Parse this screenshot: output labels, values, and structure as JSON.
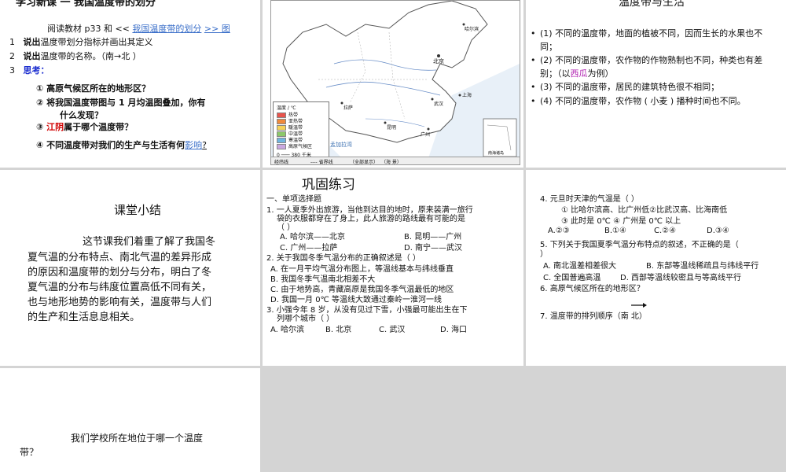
{
  "p1": {
    "title": "学习新课  一 我国温度带的划分",
    "read_prefix": "阅读教材 p33 和 <<",
    "read_link": "我国温度带的划分",
    "read_suffix": ">> 图",
    "item1_num": "1",
    "item1_bold": "说出",
    "item1_text": "温度带划分指标并画出其定义",
    "item2_num": "2",
    "item2_bold": "说出",
    "item2_text": "温度带的名称。（南→北 ）",
    "item3_num": "3",
    "item3_label": "思考：",
    "think1": "① 高原气候区所在的地形区？",
    "think2a": "② 将我国温度带图与 1 月均温图叠加，你有",
    "think2b": "什么发现？",
    "think3_prefix": "③ ",
    "think3_red": "江阴",
    "think3_suffix": "属于哪个温度带？",
    "think4_prefix": "④ 不同温度带对我们的生产与生活有何",
    "think4_link": "影响",
    "think4_suffix": "?"
  },
  "p2": {
    "legend_title": "温度 / ℃",
    "legend_items": [
      "热带",
      "亚热带",
      "暖温带",
      "中温带",
      "寒温带",
      "高原气候区"
    ],
    "legend_colors": [
      "#e8544c",
      "#f08a3c",
      "#f6d25a",
      "#8cc86a",
      "#6fb6e0",
      "#c9a8e0"
    ],
    "scale": "0 ─── 380 千米",
    "city_beijing": "北京",
    "city_harbin": "哈尔滨",
    "city_shanghai": "上海",
    "city_guangzhou": "广州",
    "city_lhasa": "拉萨",
    "city_wuhan": "武汉",
    "city_kunming": "昆明",
    "sea_label": "孟加拉湾",
    "inset_label": "南海诸岛",
    "bottom_a": "经纬线",
    "bottom_b": "---- 省界线",
    "bottom_c": "（全部显示）",
    "bottom_d": "（海 景）"
  },
  "p3": {
    "title": "温度带与生活",
    "b1": "(1) 不同的温度带，地面的植被不同，因而生长的水果也不同；",
    "b2_prefix": "(2) 不同的温度带，农作物的作物熟制也不同，种类也有差别；（以",
    "b2_purple": "西瓜",
    "b2_suffix": "为例）",
    "b3": "(3) 不同的温度带，居民的建筑特色很不相同；",
    "b4": "(4) 不同的温度带，农作物 ( 小麦 ) 播种时间也不同。"
  },
  "p4": {
    "title": "课堂小结",
    "lines": [
      "这节课我们着重了解了我国冬",
      "夏气温的分布特点、南北气温的差异形成",
      "的原因和温度带的划分与分布，明白了冬",
      "夏气温的分布与纬度位置高低不同有关，",
      "也与地形地势的影响有关，温度带与人们",
      "的生产和生活息息相关。"
    ]
  },
  "p5": {
    "title": "巩固练习",
    "section": "一、单项选择题",
    "q1a": "1. 一人夏季外出旅游，当他到达目的地时，原来装满一旅行",
    "q1b": "袋的衣服都穿在了身上，此人旅游的路线最有可能的是",
    "q1c": "（     ）",
    "q1_A": "A. 哈尔滨——北京",
    "q1_B": "B. 昆明——广州",
    "q1_C": "C. 广州——拉萨",
    "q1_D": "D. 南宁——武汉",
    "q2": "2. 关于我国冬季气温分布的正确叙述是（       ）",
    "q2_A": "A. 在一月平均气温分布图上，等温线基本与纬线垂直",
    "q2_B": "B. 我国冬季气温南北相差不大",
    "q2_C": "C. 由于地势高，青藏高原是我国冬季气温最低的地区",
    "q2_D": "D. 我国一月 0℃ 等温线大致通过秦岭一淮河一线",
    "q3a": "3. 小强今年 8 岁，从没有见过下雪，小强最可能出生在下",
    "q3b": "列哪个城市（       ）",
    "q3_A": "A. 哈尔滨",
    "q3_B": "B. 北京",
    "q3_C": "C. 武汉",
    "q3_D": "D. 海口"
  },
  "p6": {
    "q4": "4. 元旦时天津的气温是（       ）",
    "q4_1": "① 比哈尔滨高、比广州低②比武汉高、比海南低",
    "q4_2": "③ 此时是 0℃     ④ 广州是 0℃ 以上",
    "q4_A": "A.②③",
    "q4_B": "B.①④",
    "q4_C": "C.②④",
    "q4_D": "D.③④",
    "q5a": "5. 下列关于我国夏季气温分布特点的叙述，不正确的是（",
    "q5b": "）",
    "q5_A": "A. 南北温差相差很大",
    "q5_B": "B. 东部等温线稀疏且与纬线平行",
    "q5_C": "C. 全国普遍高温",
    "q5_D": "D. 西部等温线较密且与等高线平行",
    "q6": "6. 高原气候区所在的地形区？",
    "q7": "7. 温度带的排列顺序（南          北）"
  },
  "p7": {
    "line1": "我们学校所在地位于哪一个温度",
    "line2": "带？"
  }
}
